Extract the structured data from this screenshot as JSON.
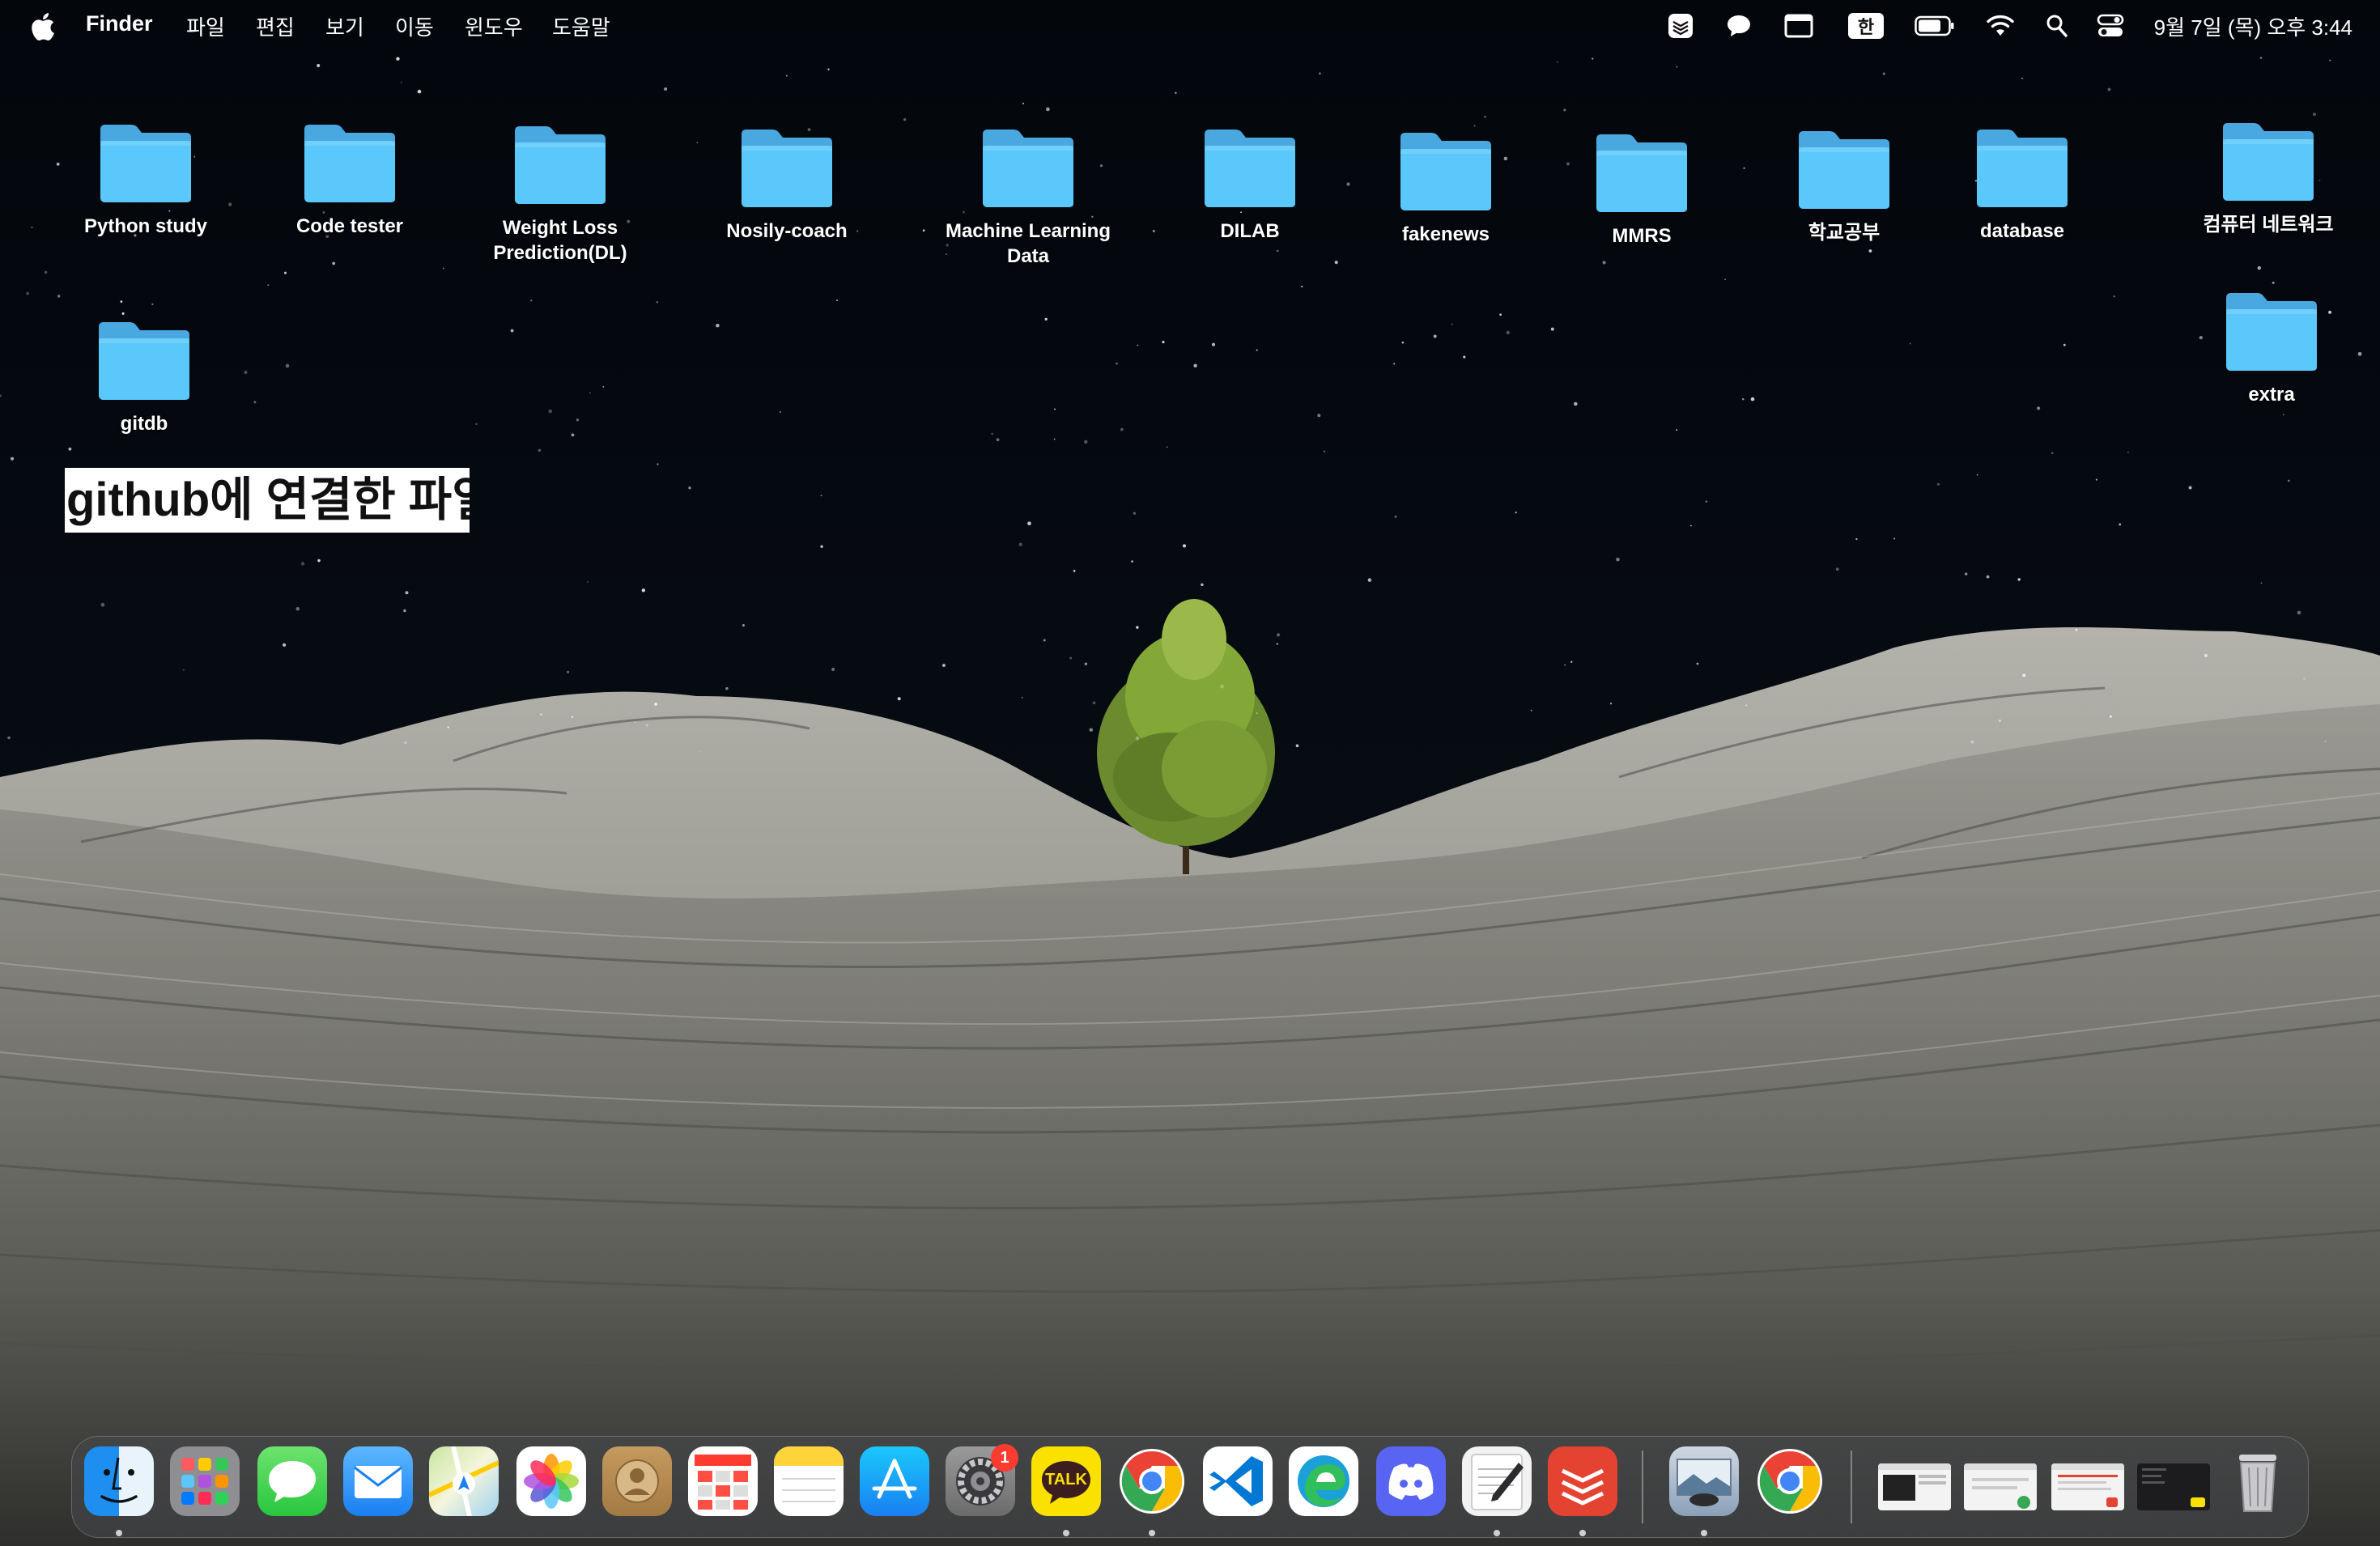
{
  "menubar": {
    "app_name": "Finder",
    "menus": [
      "파일",
      "편집",
      "보기",
      "이동",
      "윈도우",
      "도움말"
    ],
    "input_method": "한",
    "clock": "9월 7일 (목) 오후 3:44"
  },
  "desktop": {
    "folders": [
      {
        "name": "Python study"
      },
      {
        "name": "Code tester"
      },
      {
        "name": "Weight Loss Prediction(DL)"
      },
      {
        "name": "Nosily-coach"
      },
      {
        "name": "Machine Learning Data"
      },
      {
        "name": "DILAB"
      },
      {
        "name": "fakenews"
      },
      {
        "name": "MMRS"
      },
      {
        "name": "학교공부"
      },
      {
        "name": "database"
      },
      {
        "name": "컴퓨터 네트워크"
      },
      {
        "name": "gitdb"
      },
      {
        "name": "extra"
      }
    ],
    "note_text": "github에 연결한 파일"
  },
  "dock": {
    "apps": [
      "finder",
      "launchpad",
      "messages",
      "mail",
      "maps",
      "photos",
      "contacts",
      "calendar",
      "notes",
      "app-store",
      "system-settings",
      "kakaotalk",
      "chrome",
      "vscode",
      "edge",
      "discord",
      "textedit",
      "todoist",
      "preview",
      "chrome-2"
    ],
    "system_settings_badge": "1",
    "kakaotalk_label": "TALK"
  },
  "colors": {
    "folder_blue": "#5ac8fa",
    "folder_tab": "#4aa8e0",
    "badge_red": "#ff3b30",
    "kakao_yellow": "#fae100"
  }
}
